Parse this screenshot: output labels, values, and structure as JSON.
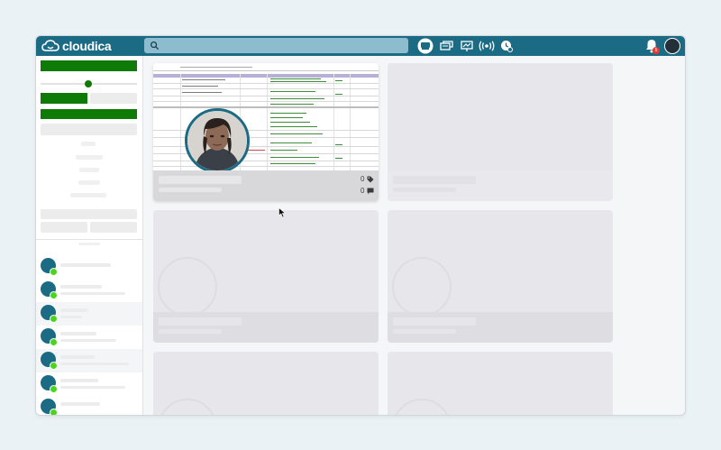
{
  "app": {
    "brand_name": "cloudica",
    "brand_color": "#1c6b85",
    "accent_green": "#0d7b06",
    "status_green": "#4dd21d",
    "notification_badge_color": "#e53935"
  },
  "header": {
    "search_placeholder": "",
    "icons": [
      "meeting-icon",
      "chat-icon",
      "presentation-icon",
      "broadcast-icon",
      "clock-icon"
    ],
    "notification_count": "5"
  },
  "active_card": {
    "tag_count": "0",
    "comment_count": "0"
  },
  "sidebar": {
    "slider_value": 0.5,
    "contacts_count": 7
  }
}
